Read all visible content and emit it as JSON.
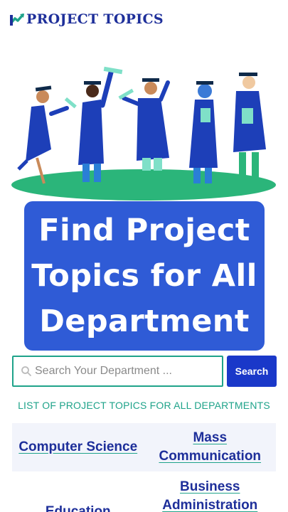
{
  "header": {
    "logo_text": "PROJECT TOPICS",
    "logo_icon": "arrow-chart-icon"
  },
  "hero": {
    "image": "graduates-illustration"
  },
  "headline": "Find Project Topics for All Department",
  "search": {
    "placeholder": "Search Your Department ...",
    "value": "",
    "button_label": "Search"
  },
  "list_title": "LIST OF PROJECT TOPICS FOR ALL DEPARTMENTS",
  "departments": [
    "Computer Science",
    "Mass Communication",
    "Education",
    "Business Administration"
  ],
  "colors": {
    "brand": "#1e2f9a",
    "accent": "#1fa38a",
    "headline_bg": "#2f5bd6",
    "button_bg": "#1a38c9"
  }
}
